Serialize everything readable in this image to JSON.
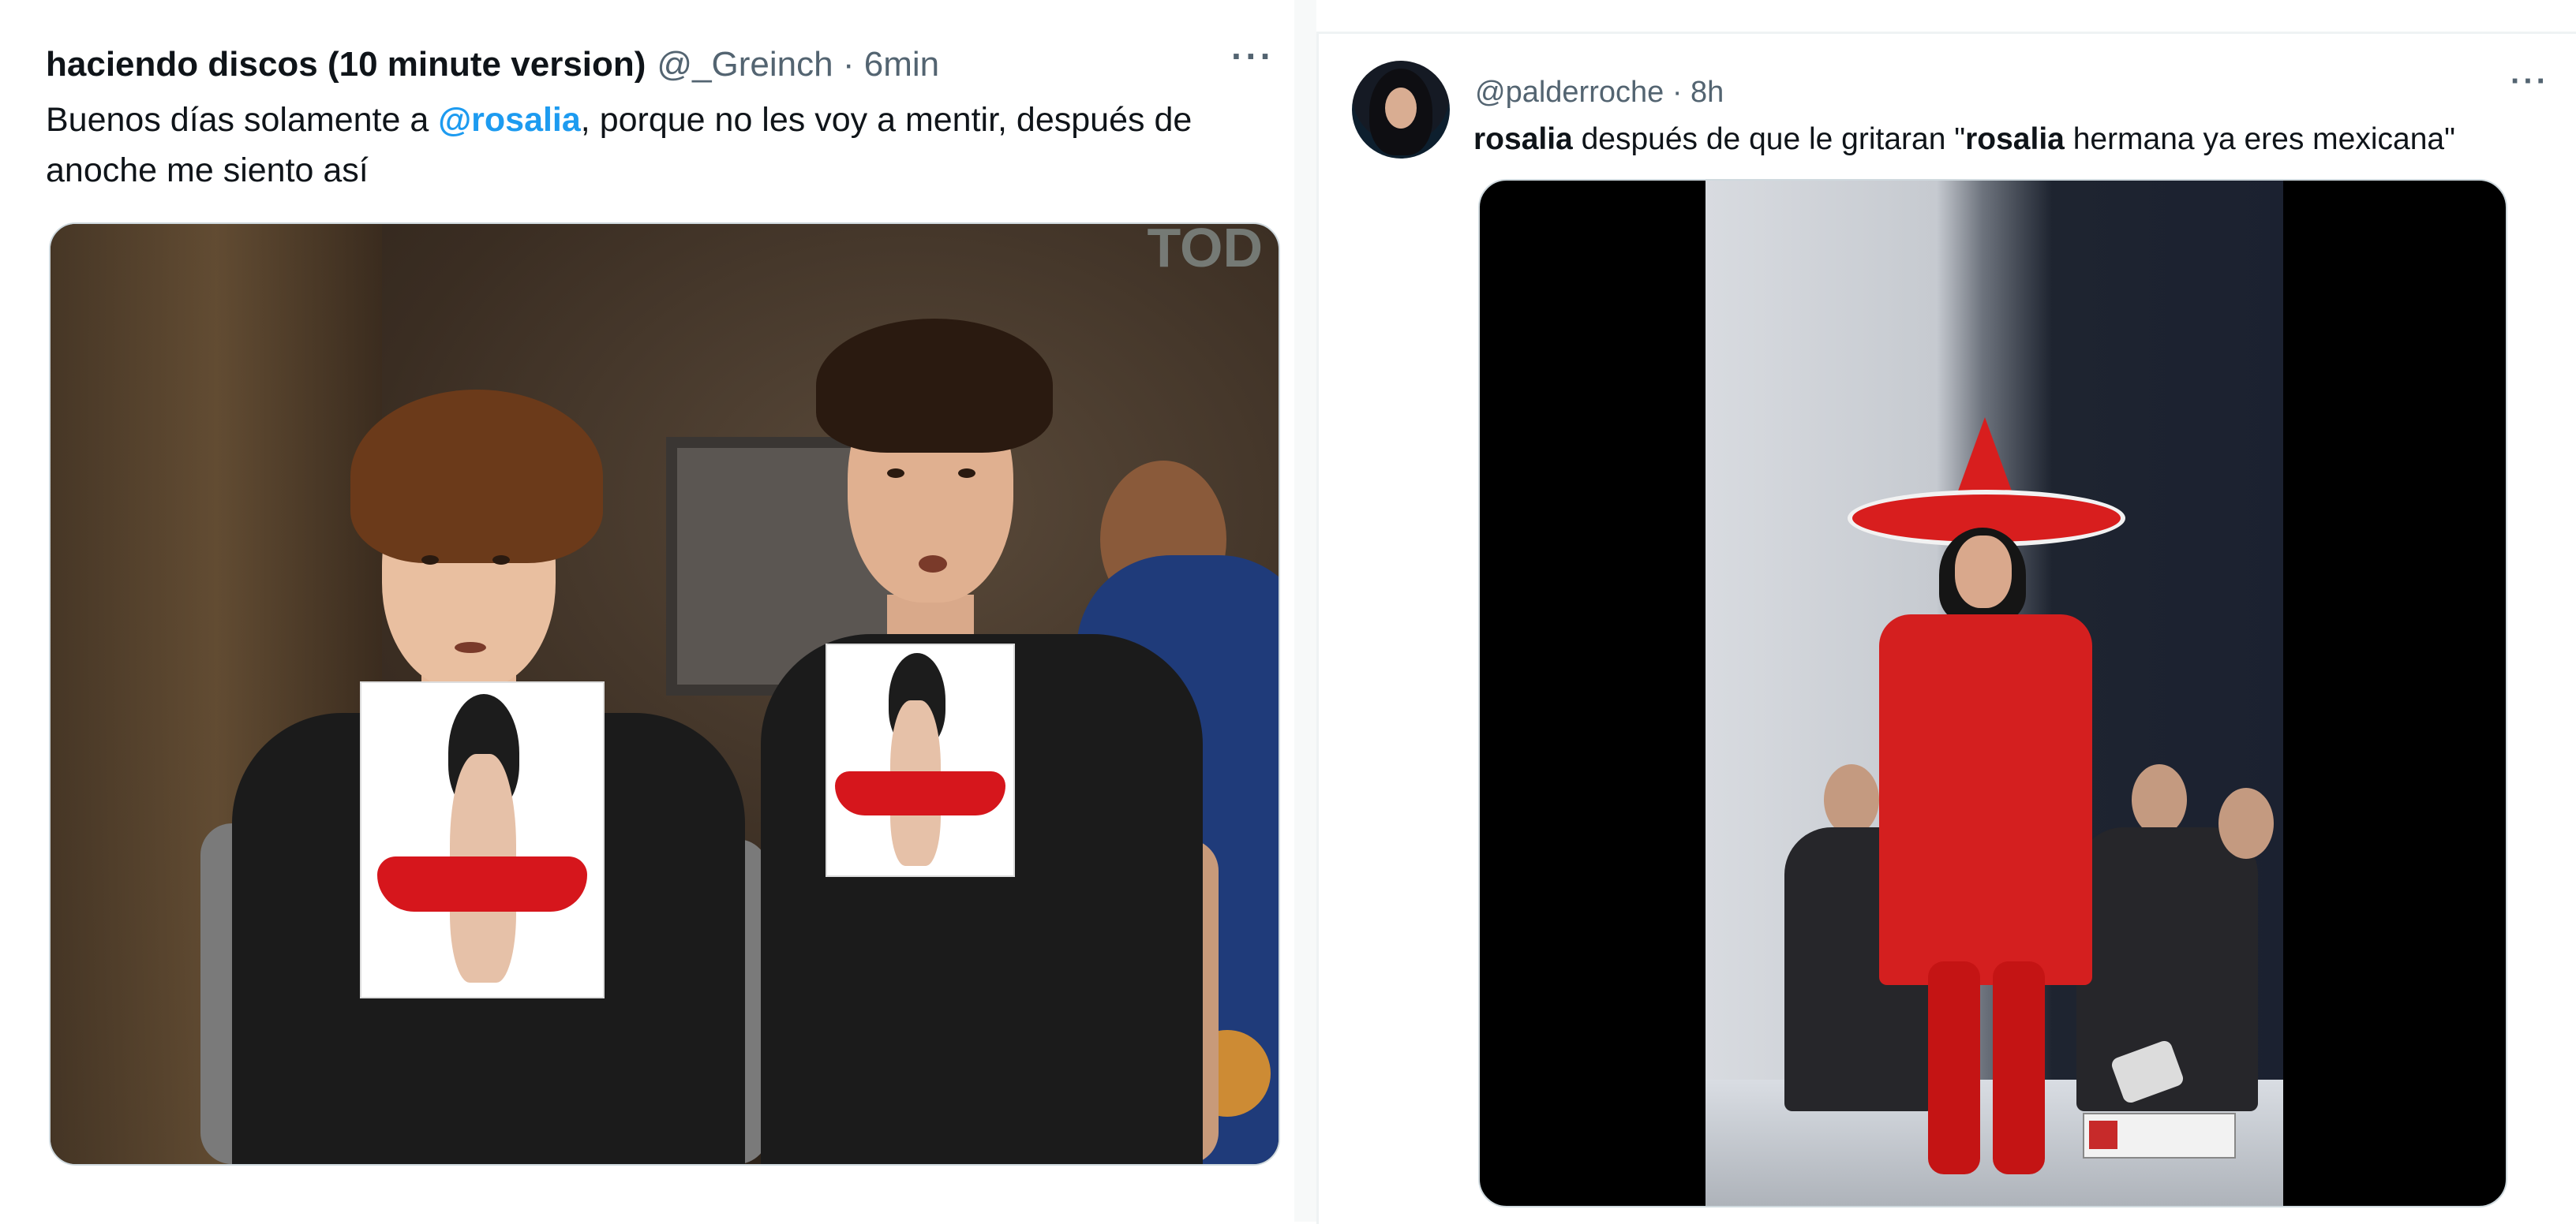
{
  "left_tweet": {
    "name": "haciendo discos (10 minute version)",
    "handle_time": "@_Greinch · 6min",
    "more": "···",
    "text_before": "Buenos días solamente a ",
    "mention": "@rosalia",
    "text_after": ", porque no les voy a mentir, después de anoche me siento así",
    "media_alt": "meme image"
  },
  "right_tweet": {
    "handle_time": "@palderroche · 8h",
    "more": "···",
    "text_bold1": "rosalia",
    "text_mid": " después de que le gritaran \"",
    "text_bold2": "rosalia",
    "text_end": " hermana ya eres mexicana\"",
    "media_alt": "concert video"
  },
  "colors": {
    "link": "#1d9bf0",
    "secondary_text": "#536471",
    "border": "#cfd9de"
  },
  "icons": [
    "more-icon",
    "avatar"
  ]
}
